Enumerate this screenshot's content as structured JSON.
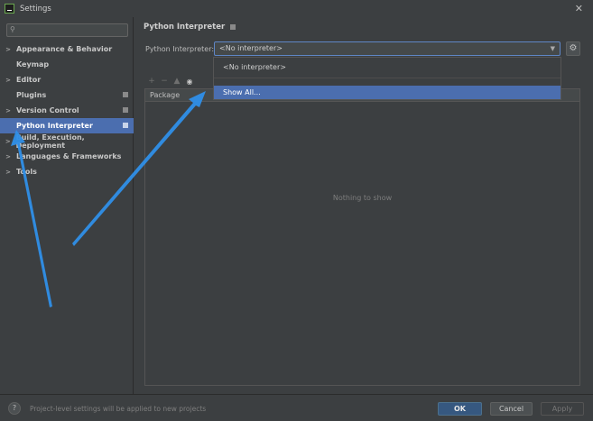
{
  "window": {
    "title": "Settings"
  },
  "sidebar": {
    "search": {
      "value": "",
      "placeholder": ""
    },
    "items": [
      {
        "label": "Appearance & Behavior",
        "expandable": true,
        "has_settings_icon": false
      },
      {
        "label": "Keymap",
        "expandable": false,
        "has_settings_icon": false
      },
      {
        "label": "Editor",
        "expandable": true,
        "has_settings_icon": false
      },
      {
        "label": "Plugins",
        "expandable": false,
        "has_settings_icon": true
      },
      {
        "label": "Version Control",
        "expandable": true,
        "has_settings_icon": true
      },
      {
        "label": "Python Interpreter",
        "expandable": false,
        "has_settings_icon": true,
        "selected": true
      },
      {
        "label": "Build, Execution, Deployment",
        "expandable": true,
        "has_settings_icon": false
      },
      {
        "label": "Languages & Frameworks",
        "expandable": true,
        "has_settings_icon": false
      },
      {
        "label": "Tools",
        "expandable": true,
        "has_settings_icon": false
      }
    ]
  },
  "main": {
    "title": "Python Interpreter",
    "interpreter_label": "Python Interpreter:",
    "interpreter_value": "<No interpreter>",
    "toolbar_icons": [
      "plus-icon",
      "minus-icon",
      "up-arrow-icon",
      "eye-icon"
    ],
    "table": {
      "columns": [
        "Package"
      ],
      "empty_text": "Nothing to show"
    }
  },
  "dropdown": {
    "options": [
      "<No interpreter>",
      "Show All..."
    ],
    "highlighted": "Show All..."
  },
  "footer": {
    "help_label": "?",
    "hint": "Project-level settings will be applied to new projects",
    "ok_label": "OK",
    "cancel_label": "Cancel",
    "apply_label": "Apply"
  },
  "colors": {
    "background": "#3c3f41",
    "selection": "#4b6eaf",
    "primary_button": "#365880",
    "annotation_arrow": "#2f8fe8"
  }
}
